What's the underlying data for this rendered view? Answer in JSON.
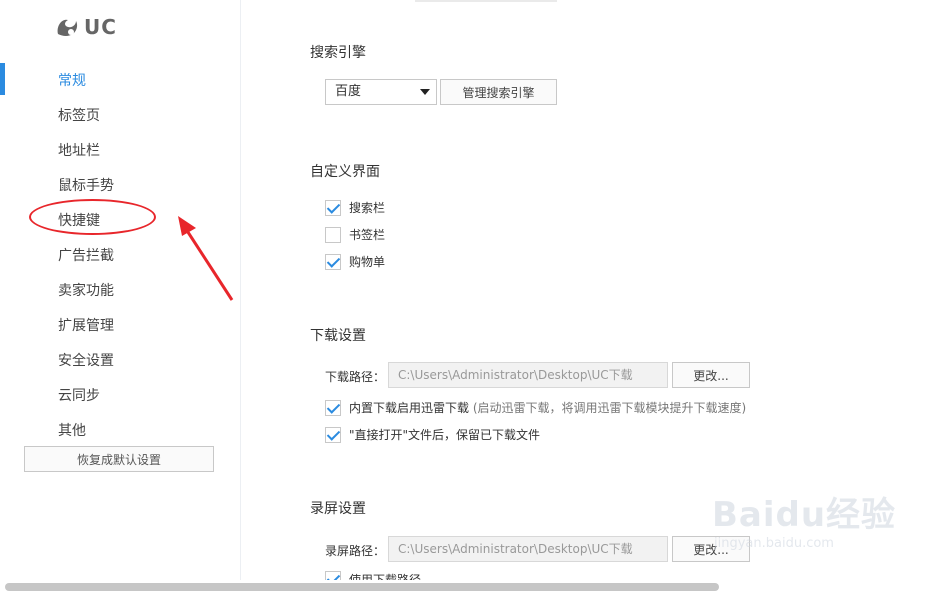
{
  "app": {
    "logo_text": "UC"
  },
  "sidebar": {
    "items": [
      {
        "label": "常规",
        "active": true
      },
      {
        "label": "标签页"
      },
      {
        "label": "地址栏"
      },
      {
        "label": "鼠标手势"
      },
      {
        "label": "快捷键"
      },
      {
        "label": "广告拦截"
      },
      {
        "label": "卖家功能"
      },
      {
        "label": "扩展管理"
      },
      {
        "label": "安全设置"
      },
      {
        "label": "云同步"
      },
      {
        "label": "其他"
      }
    ],
    "restore_label": "恢复成默认设置"
  },
  "search": {
    "title": "搜索引擎",
    "engine_selected": "百度",
    "manage_label": "管理搜索引擎"
  },
  "custom_ui": {
    "title": "自定义界面",
    "options": [
      {
        "label": "搜索栏",
        "checked": true
      },
      {
        "label": "书签栏",
        "checked": false
      },
      {
        "label": "购物单",
        "checked": true
      }
    ]
  },
  "download": {
    "title": "下载设置",
    "path_label": "下载路径：",
    "path_value": "C:\\Users\\Administrator\\Desktop\\UC下载",
    "change_label": "更改...",
    "option1_label": "内置下载启用迅雷下载",
    "option1_hint": "(启动迅雷下载，将调用迅雷下载模块提升下载速度)",
    "option2_label": "\"直接打开\"文件后，保留已下载文件"
  },
  "record": {
    "title": "录屏设置",
    "path_label": "录屏路径：",
    "path_value": "C:\\Users\\Administrator\\Desktop\\UC下载",
    "change_label": "更改...",
    "option_partial": "使用下载路径"
  },
  "watermark": {
    "main": "Baidu经验",
    "sub": "jingyan.baidu.com"
  },
  "colors": {
    "accent": "#2b8be0",
    "annotation": "#e8262b"
  }
}
